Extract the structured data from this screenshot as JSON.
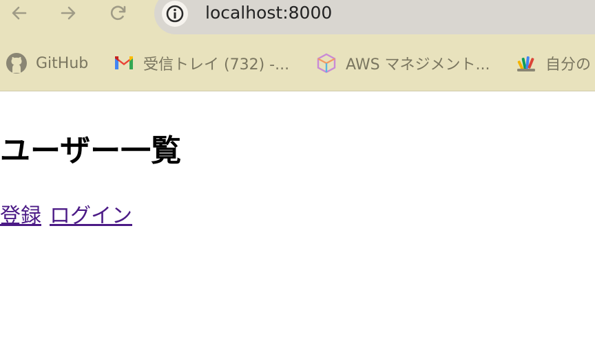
{
  "browser": {
    "url": "localhost:8000",
    "icons": {
      "back": "arrow-left-icon",
      "forward": "arrow-right-icon",
      "reload": "reload-icon",
      "site_info": "info-icon"
    },
    "bookmarks": [
      {
        "label": "GitHub",
        "icon": "github-icon"
      },
      {
        "label": "受信トレイ (732) -...",
        "icon": "gmail-icon"
      },
      {
        "label": "AWS マネジメント...",
        "icon": "aws-icon"
      },
      {
        "label": "自分の",
        "icon": "apps-script-icon"
      }
    ]
  },
  "page": {
    "title": "ユーザー一覧",
    "links": [
      {
        "label": "登録"
      },
      {
        "label": "ログイン"
      }
    ],
    "link_color": "#4b1a86"
  }
}
